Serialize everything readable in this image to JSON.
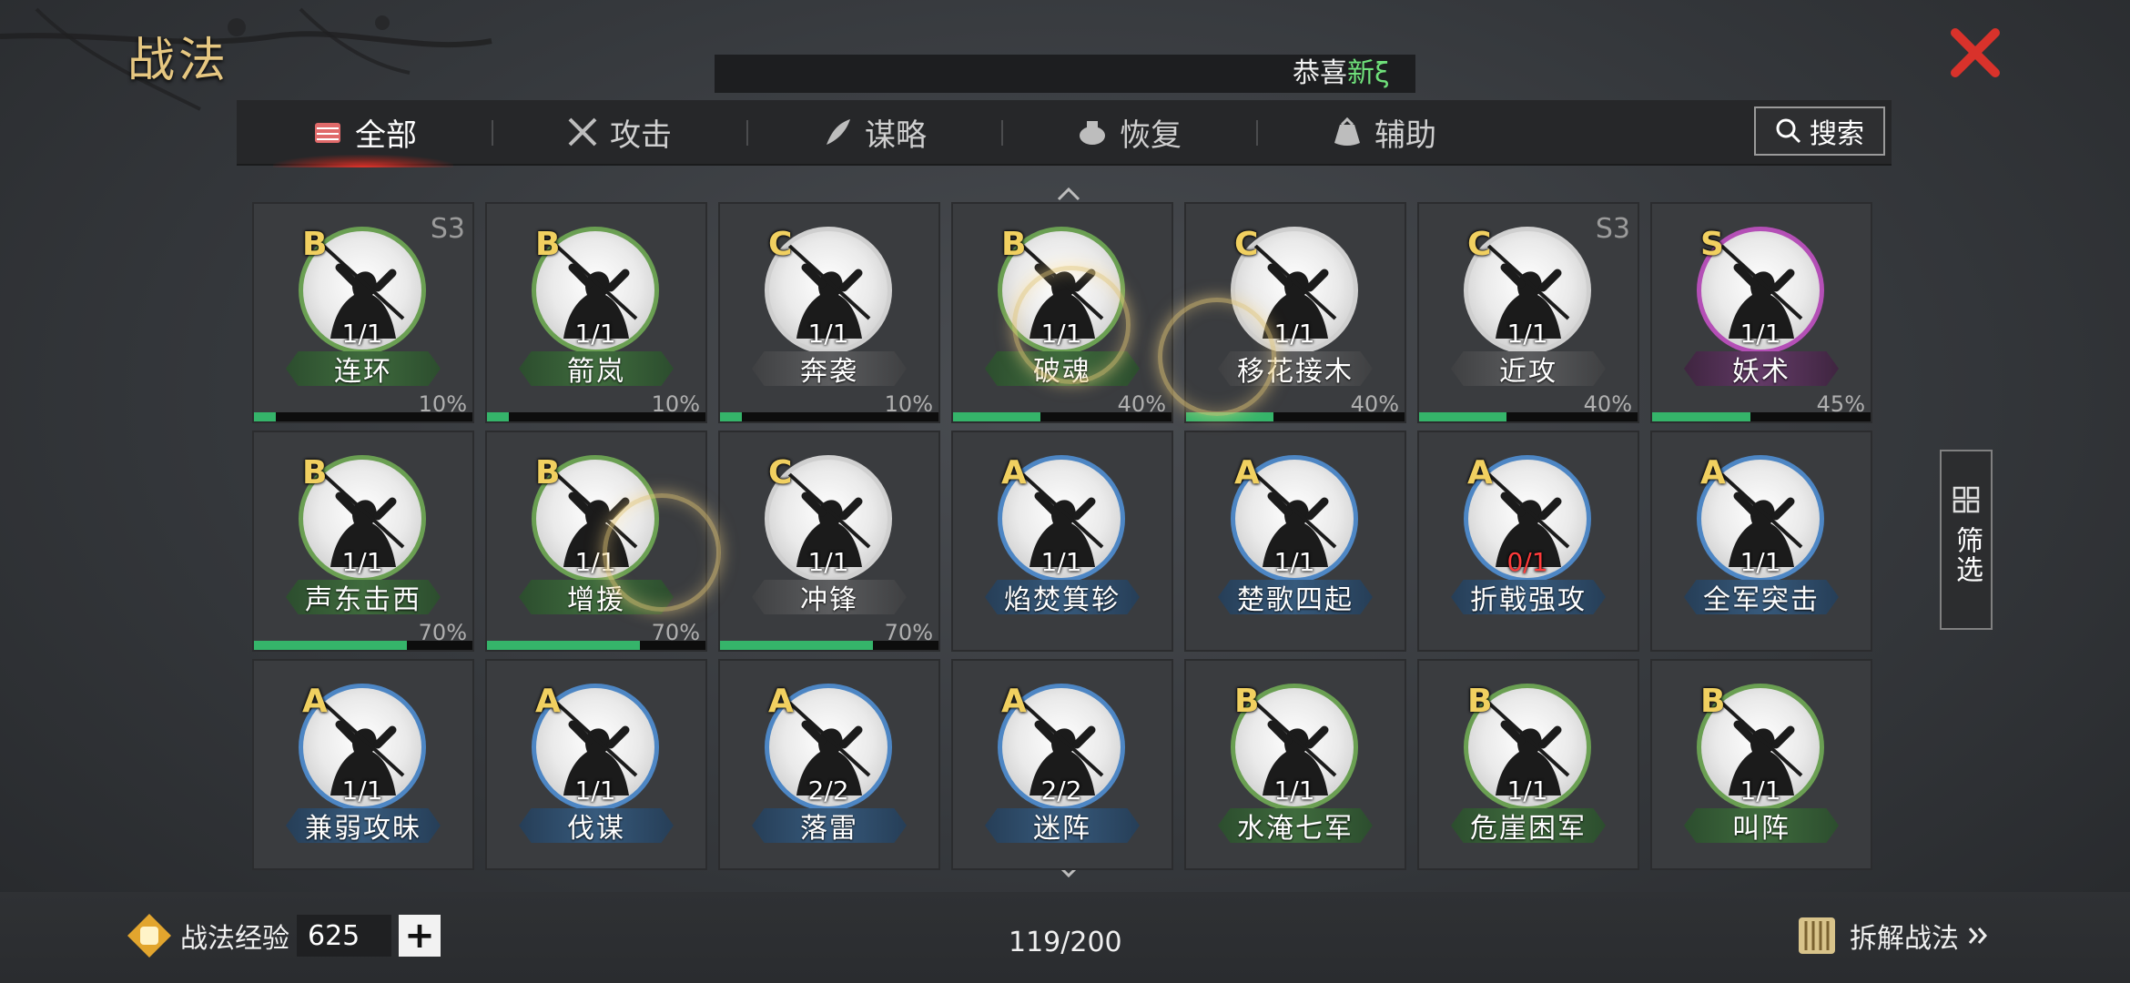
{
  "header": {
    "title": "战法"
  },
  "ticker": {
    "prefix": "恭喜",
    "highlight": "新ξ"
  },
  "tabs": [
    {
      "label": "全部",
      "icon": "scroll-bundle-icon",
      "active": true
    },
    {
      "label": "攻击",
      "icon": "crossed-swords-icon",
      "active": false
    },
    {
      "label": "谋略",
      "icon": "feather-hand-icon",
      "active": false
    },
    {
      "label": "恢复",
      "icon": "medicine-pot-icon",
      "active": false
    },
    {
      "label": "辅助",
      "icon": "pouch-icon",
      "active": false
    }
  ],
  "search": {
    "label": "搜索"
  },
  "filter": {
    "label": "筛选"
  },
  "colors": {
    "green": "#6a9f52",
    "white": "#cfcfcf",
    "purple": "#b44fb6",
    "blue": "#4d86c4",
    "progress": "#35b46a",
    "grade": "#f1d060",
    "title": "#e6c781",
    "close": "#d9322b"
  },
  "cards": [
    {
      "grade": "B",
      "count": "1/1",
      "name": "连环",
      "season": "S3",
      "percent": "10%",
      "progress": 0.1,
      "quality": "green"
    },
    {
      "grade": "B",
      "count": "1/1",
      "name": "箭岚",
      "season": "",
      "percent": "10%",
      "progress": 0.1,
      "quality": "green"
    },
    {
      "grade": "C",
      "count": "1/1",
      "name": "奔袭",
      "season": "",
      "percent": "10%",
      "progress": 0.1,
      "quality": "white"
    },
    {
      "grade": "B",
      "count": "1/1",
      "name": "破魂",
      "season": "",
      "percent": "40%",
      "progress": 0.4,
      "quality": "green"
    },
    {
      "grade": "C",
      "count": "1/1",
      "name": "移花接木",
      "season": "",
      "percent": "40%",
      "progress": 0.4,
      "quality": "white"
    },
    {
      "grade": "C",
      "count": "1/1",
      "name": "近攻",
      "season": "S3",
      "percent": "40%",
      "progress": 0.4,
      "quality": "white"
    },
    {
      "grade": "S",
      "count": "1/1",
      "name": "妖术",
      "season": "",
      "percent": "45%",
      "progress": 0.45,
      "quality": "purple"
    },
    {
      "grade": "B",
      "count": "1/1",
      "name": "声东击西",
      "season": "",
      "percent": "70%",
      "progress": 0.7,
      "quality": "green"
    },
    {
      "grade": "B",
      "count": "1/1",
      "name": "增援",
      "season": "",
      "percent": "70%",
      "progress": 0.7,
      "quality": "green"
    },
    {
      "grade": "C",
      "count": "1/1",
      "name": "冲锋",
      "season": "",
      "percent": "70%",
      "progress": 0.7,
      "quality": "white"
    },
    {
      "grade": "A",
      "count": "1/1",
      "name": "焰焚箕轸",
      "season": "",
      "percent": "",
      "progress": null,
      "quality": "blue"
    },
    {
      "grade": "A",
      "count": "1/1",
      "name": "楚歌四起",
      "season": "",
      "percent": "",
      "progress": null,
      "quality": "blue"
    },
    {
      "grade": "A",
      "count": "0/1",
      "name": "折戟强攻",
      "season": "",
      "percent": "",
      "progress": null,
      "quality": "blue",
      "count_red": true
    },
    {
      "grade": "A",
      "count": "1/1",
      "name": "全军突击",
      "season": "",
      "percent": "",
      "progress": null,
      "quality": "blue"
    },
    {
      "grade": "A",
      "count": "1/1",
      "name": "兼弱攻昧",
      "season": "",
      "percent": "",
      "progress": null,
      "quality": "blue"
    },
    {
      "grade": "A",
      "count": "1/1",
      "name": "伐谋",
      "season": "",
      "percent": "",
      "progress": null,
      "quality": "blue"
    },
    {
      "grade": "A",
      "count": "2/2",
      "name": "落雷",
      "season": "",
      "percent": "",
      "progress": null,
      "quality": "blue"
    },
    {
      "grade": "A",
      "count": "2/2",
      "name": "迷阵",
      "season": "",
      "percent": "",
      "progress": null,
      "quality": "blue"
    },
    {
      "grade": "B",
      "count": "1/1",
      "name": "水淹七军",
      "season": "",
      "percent": "",
      "progress": null,
      "quality": "green"
    },
    {
      "grade": "B",
      "count": "1/1",
      "name": "危崖困军",
      "season": "",
      "percent": "",
      "progress": null,
      "quality": "green"
    },
    {
      "grade": "B",
      "count": "1/1",
      "name": "叫阵",
      "season": "",
      "percent": "",
      "progress": null,
      "quality": "green"
    }
  ],
  "footer": {
    "exp_label": "战法经验",
    "exp_value": "625",
    "capacity": "119/200",
    "dismantle_label": "拆解战法"
  }
}
